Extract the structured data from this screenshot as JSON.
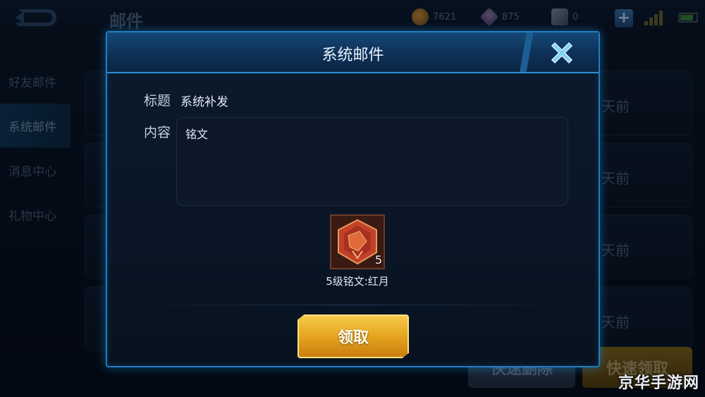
{
  "header": {
    "title": "邮件",
    "resources": [
      {
        "name": "gold-coin",
        "value": "7621"
      },
      {
        "name": "diamond",
        "value": "875"
      },
      {
        "name": "ticket",
        "value": "0"
      }
    ]
  },
  "sidebar": {
    "items": [
      {
        "label": "好友邮件",
        "active": false
      },
      {
        "label": "系统邮件",
        "active": true
      },
      {
        "label": "消息中心",
        "active": false
      },
      {
        "label": "礼物中心",
        "active": false
      }
    ]
  },
  "mail_list": {
    "times": [
      "天前",
      "天前",
      "天前",
      "天前"
    ]
  },
  "bulk_actions": {
    "delete_label": "快速删除",
    "claim_label": "快速领取"
  },
  "modal": {
    "title": "系统邮件",
    "subject_label": "标题",
    "subject_value": "系统补发",
    "content_label": "内容",
    "content_value": "铭文",
    "attachment": {
      "count": "5",
      "name": "5级铭文:红月"
    },
    "claim_label": "领取"
  },
  "watermark": "京华手游网",
  "colors": {
    "accent_blue": "#1f7fbf",
    "gold_button": "#e6a520",
    "panel_bg": "#0a1626"
  }
}
